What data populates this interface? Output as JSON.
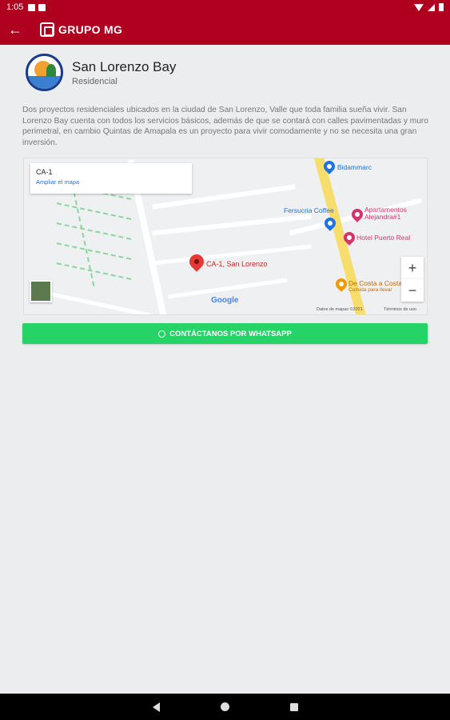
{
  "status_bar": {
    "time": "1:05"
  },
  "app_bar": {
    "back_icon": "arrow-left-icon",
    "logo_text": "GRUPO MG",
    "color": "#b00020"
  },
  "project": {
    "title": "San Lorenzo Bay",
    "category": "Residencial",
    "description": "Dos proyectos residenciales ubicados en la ciudad de San Lorenzo, Valle que toda familia sueña vivir. San Lorenzo Bay cuenta con todos los servicios básicos, además de que se contará con calles pavimentadas y muro perimetral, en cambio Quintas de Amapala es un proyecto para vivir comodamente y no se necesita una gran inversión."
  },
  "map": {
    "info_title": "CA-1",
    "info_link": "Ampliar el mapa",
    "pin_label": "CA-1, San Lorenzo",
    "pois": [
      {
        "name": "Bidammarc",
        "color": "blue"
      },
      {
        "name": "Fersucria Coffee",
        "color": "blue"
      },
      {
        "name": "Apartamentos Alejandra#1",
        "color": "pink"
      },
      {
        "name": "Hotel Puerto Real",
        "color": "pink"
      },
      {
        "name": "De Costa a Costa",
        "color": "orange"
      }
    ],
    "poi_sub": "Comida para llevar",
    "zoom_in": "+",
    "zoom_out": "−",
    "google": "Google",
    "attribution": "Datos de mapas ©2021",
    "terms": "Términos de uso"
  },
  "whatsapp_button": {
    "label": "CONTÁCTANOS POR WHATSAPP",
    "color": "#25d366"
  }
}
